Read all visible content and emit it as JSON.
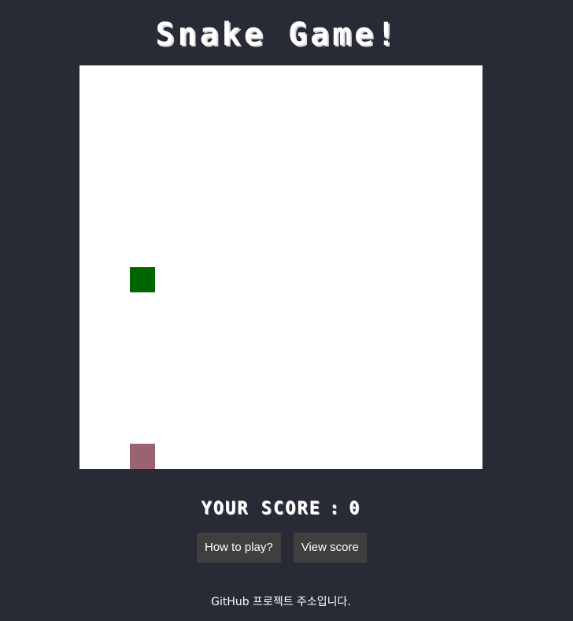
{
  "title": "Snake Game!",
  "board": {
    "cols": 16,
    "rows": 16,
    "background": "#ffffff",
    "snake": {
      "col": 2,
      "row": 8,
      "color": "#006400"
    },
    "food": {
      "col": 2,
      "row": 15,
      "color": "#9b6272"
    }
  },
  "score": {
    "label": "YOUR SCORE",
    "separator": ":",
    "value": "0"
  },
  "buttons": {
    "how_to_play": "How to play?",
    "view_score": "View score"
  },
  "footer": {
    "github_text": "GitHub 프로젝트 주소입니다."
  },
  "colors": {
    "page_background": "#282a35",
    "button_background": "#3f3f3f"
  }
}
